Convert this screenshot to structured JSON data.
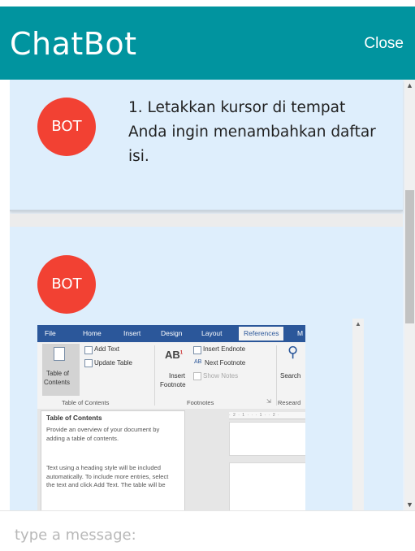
{
  "header": {
    "title": "ChatBot",
    "close_label": "Close"
  },
  "colors": {
    "header_bg": "#01949f",
    "avatar_bg": "#f24133",
    "message_bg": "#deeefc",
    "word_blue": "#2b579a"
  },
  "messages": [
    {
      "sender": "BOT",
      "text": "1. Letakkan kursor di tempat Anda ingin menambahkan daftar isi."
    },
    {
      "sender": "BOT",
      "image": {
        "tabs": [
          "File",
          "Home",
          "Insert",
          "Design",
          "Layout",
          "References",
          "M"
        ],
        "active_tab": "References",
        "toc_group": {
          "button_label_1": "Table of",
          "button_label_2": "Contents",
          "add_text": "Add Text",
          "update_table": "Update Table",
          "group_label": "Table of Contents"
        },
        "footnotes_group": {
          "insert_footnote_1": "Insert",
          "insert_footnote_2": "Footnote",
          "insert_endnote": "Insert Endnote",
          "next_footnote": "Next Footnote",
          "show_notes": "Show Notes",
          "group_label": "Footnotes"
        },
        "research_group": {
          "search": "Search",
          "group_label": "Researd"
        },
        "pane": {
          "heading": "Table of Contents",
          "para1": "Provide an overview of your document by adding a table of contents.",
          "para2": "Text using a heading style will be included automatically. To include more entries, select the text and click Add Text. The table will be"
        }
      }
    }
  ],
  "input": {
    "placeholder": "type a message:"
  }
}
